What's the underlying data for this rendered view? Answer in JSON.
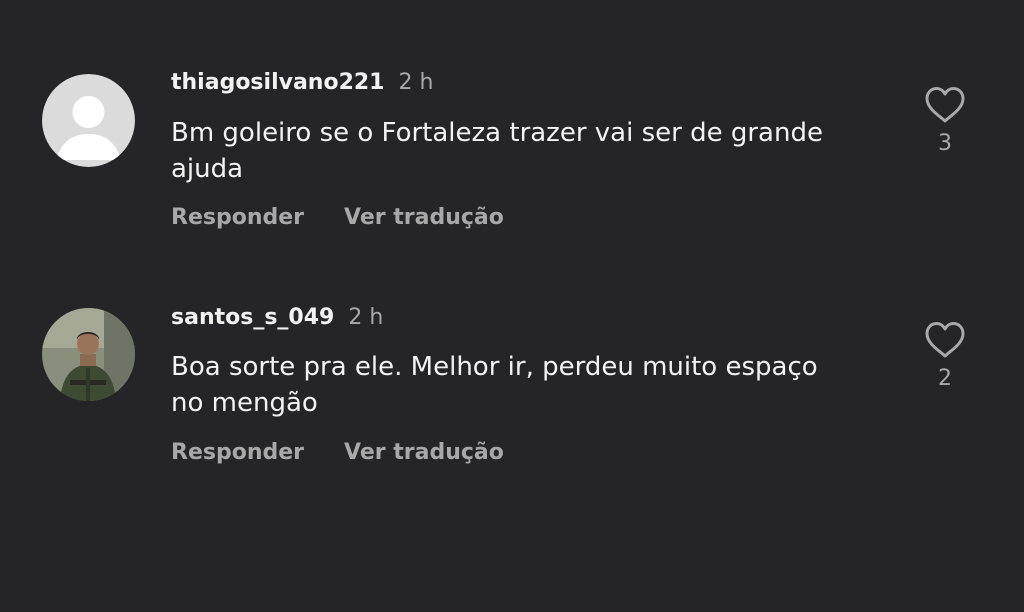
{
  "comments": [
    {
      "username": "thiagosilvano221",
      "time": "2 h",
      "text_line1": "Bm goleiro se o Fortaleza trazer vai ser de grande",
      "text_line2": "ajuda",
      "reply_label": "Responder",
      "translate_label": "Ver tradução",
      "likes": "3",
      "avatar": "default-avatar-icon"
    },
    {
      "username": "santos_s_049",
      "time": "2 h",
      "text_line1": "Boa sorte pra ele. Melhor ir, perdeu muito espaço",
      "text_line2": "no mengão",
      "reply_label": "Responder",
      "translate_label": "Ver tradução",
      "likes": "2",
      "avatar": "photo-avatar"
    }
  ],
  "colors": {
    "background": "#252527",
    "primary_text": "#f2f2f2",
    "secondary_text": "#a8a8a8"
  }
}
